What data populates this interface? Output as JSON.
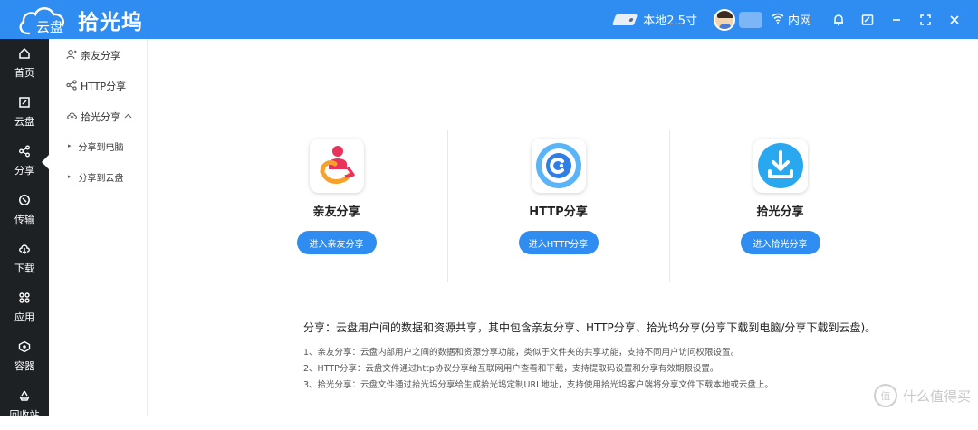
{
  "app": {
    "logo_cloud_text": "云盘",
    "name": "拾光坞",
    "colors": {
      "primary": "#2f8cf0",
      "nav_bg": "#1e2124"
    }
  },
  "topbar": {
    "disk_label": "本地2.5寸",
    "network_label": "内网",
    "icons": [
      "hard-drive-icon",
      "avatar",
      "wifi-icon",
      "bell-icon",
      "screen-icon",
      "minimize-icon",
      "fullscreen-icon",
      "close-icon"
    ]
  },
  "leftnav": {
    "items": [
      {
        "label": "首页",
        "icon": "home-icon"
      },
      {
        "label": "云盘",
        "icon": "cloud-disk-icon"
      },
      {
        "label": "分享",
        "icon": "share-icon",
        "active": true
      },
      {
        "label": "传输",
        "icon": "transfer-icon"
      },
      {
        "label": "下载",
        "icon": "download-icon"
      },
      {
        "label": "应用",
        "icon": "apps-icon"
      },
      {
        "label": "容器",
        "icon": "container-icon"
      },
      {
        "label": "回收站",
        "icon": "recycle-icon"
      }
    ]
  },
  "subnav": {
    "items": [
      {
        "label": "亲友分享",
        "icon": "user-share-icon"
      },
      {
        "label": "HTTP分享",
        "icon": "link-share-icon"
      },
      {
        "label": "拾光分享",
        "icon": "cloud-upload-icon",
        "expanded": true
      }
    ],
    "children": [
      {
        "label": "分享到电脑"
      },
      {
        "label": "分享到云盘"
      }
    ]
  },
  "cards": [
    {
      "title": "亲友分享",
      "button": "进入亲友分享",
      "icon": "friends-share-icon"
    },
    {
      "title": "HTTP分享",
      "button": "进入HTTP分享",
      "icon": "http-share-icon"
    },
    {
      "title": "拾光分享",
      "button": "进入拾光分享",
      "icon": "download-share-icon"
    }
  ],
  "description": {
    "main": "分享：云盘用户间的数据和资源共享，其中包含亲友分享、HTTP分享、拾光坞分享(分享下载到电脑/分享下载到云盘)。",
    "lines": [
      "1、亲友分享：云盘内部用户之间的数据和资源分享功能，类似于文件夹的共享功能，支持不同用户访问权限设置。",
      "2、HTTP分享：云盘文件通过http协议分享给互联网用户查看和下载，支持提取码设置和分享有效期限设置。",
      "3、拾光分享：云盘文件通过拾光坞分享给生成拾光坞定制URL地址，支持使用拾光坞客户端将分享文件下载本地或云盘上。"
    ]
  },
  "watermark": {
    "badge": "值",
    "text": "什么值得买"
  }
}
